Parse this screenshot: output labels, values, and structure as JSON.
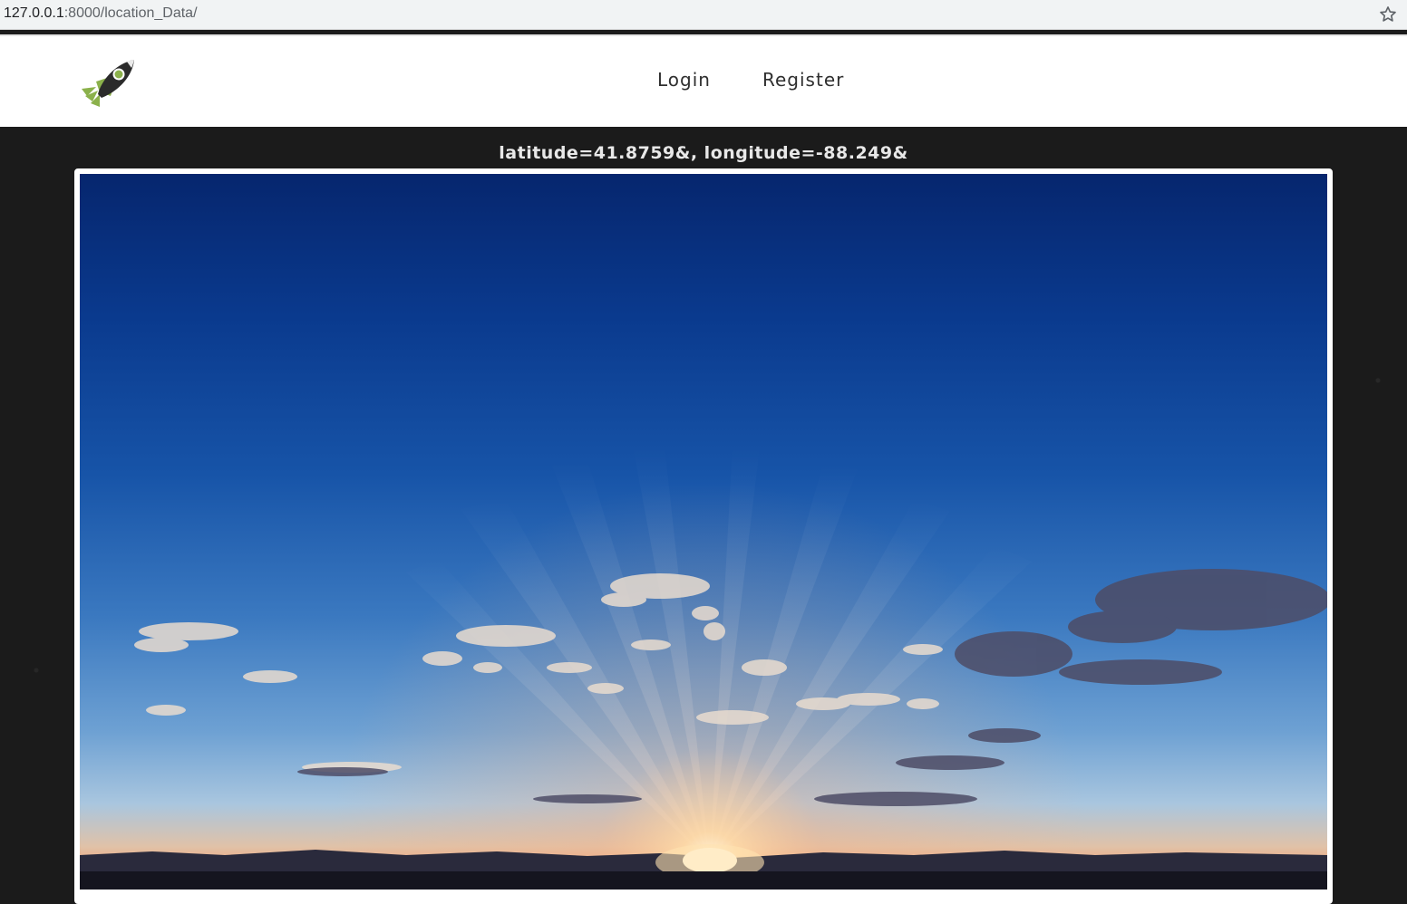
{
  "browser": {
    "url_host": "127.0.0.1",
    "url_rest": ":8000/location_Data/",
    "bookmark_icon": "star-icon"
  },
  "header": {
    "logo_icon": "rocket-icon",
    "nav": {
      "login_label": "Login",
      "register_label": "Register"
    }
  },
  "main": {
    "coordinates_text": "latitude=41.8759&, longitude=-88.249&",
    "photo_alt": "sunrise-sky-image"
  },
  "colors": {
    "header_bg": "#ffffff",
    "page_bg": "#1b1b1b",
    "rocket_green": "#8bb14b",
    "rocket_body": "#2b2b2b"
  }
}
